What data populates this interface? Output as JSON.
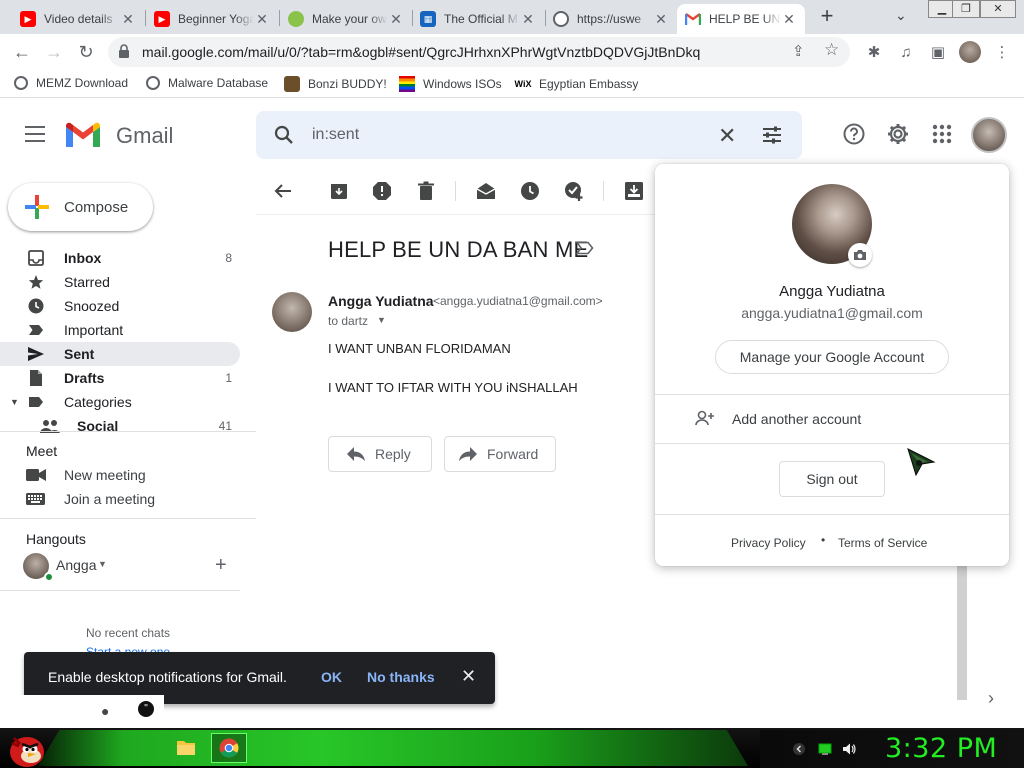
{
  "browser": {
    "tabs": [
      {
        "title": "Video details",
        "favicon": "youtube-icon",
        "color": "#ff0000"
      },
      {
        "title": "Beginner Yoga",
        "favicon": "youtube-icon",
        "color": "#ff0000"
      },
      {
        "title": "Make your own",
        "favicon": "android-icon",
        "color": "#8bc34a"
      },
      {
        "title": "The Official M",
        "favicon": "windows-icon",
        "color": "#1565c0"
      },
      {
        "title": "https://uswe",
        "favicon": "globe-icon",
        "color": "#5f6368"
      },
      {
        "title": "HELP BE UN",
        "favicon": "gmail-icon",
        "color": "#ea4335"
      }
    ],
    "new_tab_label": "+",
    "url": "mail.google.com/mail/u/0/?tab=rm&ogbl#sent/QgrcJHrhxnXPhrWgtVnztbDQDVGjJtBnDkq",
    "bookmarks": [
      {
        "label": "MEMZ Download",
        "icon": "globe-icon"
      },
      {
        "label": "Malware Database",
        "icon": "globe-icon"
      },
      {
        "label": "Bonzi BUDDY!",
        "icon": "bonzi-icon"
      },
      {
        "label": "Windows ISOs",
        "icon": "rainbow-flag-icon"
      },
      {
        "label": "Egyptian Embassy",
        "icon": "wix-icon"
      }
    ]
  },
  "gmail": {
    "logo_text": "Gmail",
    "search": {
      "value": "in:sent"
    },
    "compose_label": "Compose",
    "nav": [
      {
        "label": "Inbox",
        "count": "8",
        "bold": true
      },
      {
        "label": "Starred",
        "count": "",
        "bold": false
      },
      {
        "label": "Snoozed",
        "count": "",
        "bold": false
      },
      {
        "label": "Important",
        "count": "",
        "bold": false
      },
      {
        "label": "Sent",
        "count": "",
        "bold": true
      },
      {
        "label": "Drafts",
        "count": "1",
        "bold": true
      },
      {
        "label": "Categories",
        "count": "",
        "bold": false
      },
      {
        "label": "Social",
        "count": "41",
        "bold": true
      }
    ],
    "meet": {
      "heading": "Meet",
      "new_meeting": "New meeting",
      "join_meeting": "Join a meeting"
    },
    "hangouts": {
      "heading": "Hangouts",
      "user": "Angga",
      "no_recent": "No recent chats",
      "start_new": "Start a new one"
    },
    "message": {
      "subject": "HELP BE UN DA BAN ME",
      "sender_name": "Angga Yudiatna",
      "sender_email": "<angga.yudiatna1@gmail.com>",
      "recipient": "to dartz",
      "body": [
        "I WANT UNBAN FLORIDAMAN",
        "I WANT TO IFTAR WITH YOU iNSHALLAH"
      ],
      "reply_label": "Reply",
      "forward_label": "Forward"
    },
    "account_popup": {
      "name": "Angga Yudiatna",
      "email": "angga.yudiatna1@gmail.com",
      "manage_label": "Manage your Google Account",
      "add_account_label": "Add another account",
      "sign_out_label": "Sign out",
      "privacy_label": "Privacy Policy",
      "separator": "•",
      "terms_label": "Terms of Service"
    },
    "snackbar": {
      "text": "Enable desktop notifications for Gmail.",
      "ok_label": "OK",
      "no_thanks_label": "No thanks"
    }
  },
  "taskbar": {
    "clock": "3:32 PM",
    "accent_color": "#22ee22"
  }
}
